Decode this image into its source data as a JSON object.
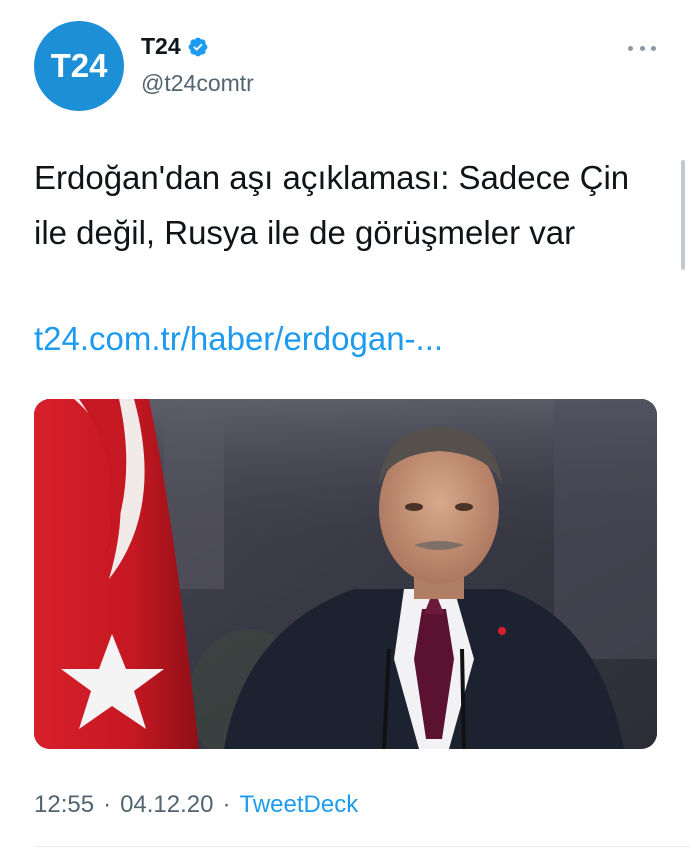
{
  "account": {
    "avatar_text": "T24",
    "display_name": "T24",
    "handle": "@t24comtr",
    "verified": true
  },
  "tweet": {
    "text": "Erdoğan'dan aşı açıklaması: Sadece Çin ile değil, Rusya ile de görüşmeler var",
    "link": "t24.com.tr/haber/erdogan-..."
  },
  "media": {
    "description_icon": "photo"
  },
  "meta": {
    "time": "12:55",
    "separator": "·",
    "date": "04.12.20",
    "source": "TweetDeck"
  },
  "colors": {
    "avatar_bg": "#1d8fd6",
    "link": "#1d9bf0",
    "muted": "#536471",
    "verified": "#1d9bf0"
  },
  "icons": {
    "verified": "verified-badge-icon",
    "more": "more-options-icon"
  }
}
